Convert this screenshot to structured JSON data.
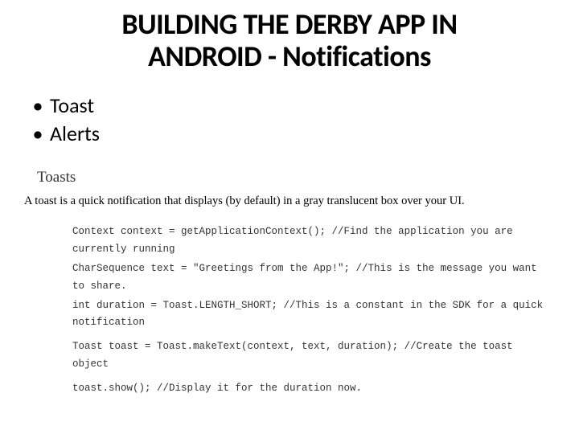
{
  "title_line1": "BUILDING THE DERBY APP IN",
  "title_line2": "ANDROID - Notifications",
  "bullets": {
    "item1": "Toast",
    "item2": "Alerts"
  },
  "section_heading": "Toasts",
  "section_desc": "A toast is a quick notification that displays (by default) in a gray translucent box over your UI.",
  "code": {
    "l1": "Context context = getApplicationContext(); //Find the application you are currently running",
    "l2": "CharSequence text = \"Greetings from the App!\"; //This is the message you want to share.",
    "l3": "int duration = Toast.LENGTH_SHORT; //This is a constant in the SDK for a quick notification",
    "l4": "Toast toast = Toast.makeText(context, text, duration); //Create the toast object",
    "l5": "toast.show(); //Display it for the duration now."
  }
}
